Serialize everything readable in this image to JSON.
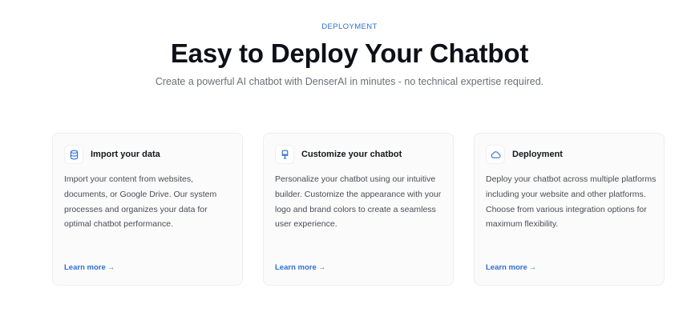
{
  "section": {
    "eyebrow": "DEPLOYMENT",
    "title": "Easy to Deploy Your Chatbot",
    "subtitle": "Create a powerful AI chatbot with DenserAI in minutes - no technical expertise required."
  },
  "cards": [
    {
      "icon": "database-icon",
      "title": "Import your data",
      "body": "Import your content from websites, documents, or Google Drive. Our system processes and organizes your data for optimal chatbot performance.",
      "link_label": "Learn more",
      "link_arrow": "→"
    },
    {
      "icon": "brush-icon",
      "title": "Customize your chatbot",
      "body": "Personalize your chatbot using our intuitive builder. Customize the appearance with your logo and brand colors to create a seamless user experience.",
      "link_label": "Learn more",
      "link_arrow": "→"
    },
    {
      "icon": "cloud-icon",
      "title": "Deployment",
      "body": "Deploy your chatbot across multiple platforms including your website and other platforms. Choose from various integration options for maximum flexibility.",
      "link_label": "Learn more",
      "link_arrow": "→"
    }
  ],
  "colors": {
    "accent": "#2f6fd8",
    "heading": "#0d1017",
    "muted": "#6b6f76",
    "card_bg": "#fbfbfb"
  }
}
